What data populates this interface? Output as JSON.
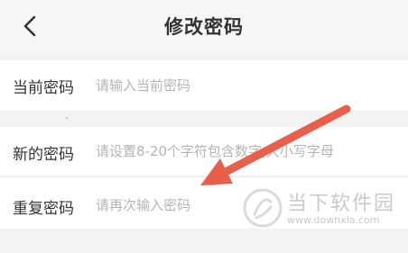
{
  "header": {
    "title": "修改密码",
    "back_icon": "chevron-left-icon"
  },
  "form": {
    "current": {
      "label": "当前密码",
      "value": "",
      "placeholder": "请输入当前密码"
    },
    "new": {
      "label": "新的密码",
      "value": "",
      "placeholder": "请设置8-20个字符包含数字,大小写字母"
    },
    "repeat": {
      "label": "重复密码",
      "value": "",
      "placeholder": "请再次输入密码"
    }
  },
  "annotation": {
    "arrow_color": "#e8604c"
  },
  "watermark": {
    "name": "当下软件园",
    "url": "www.downxia.com"
  }
}
